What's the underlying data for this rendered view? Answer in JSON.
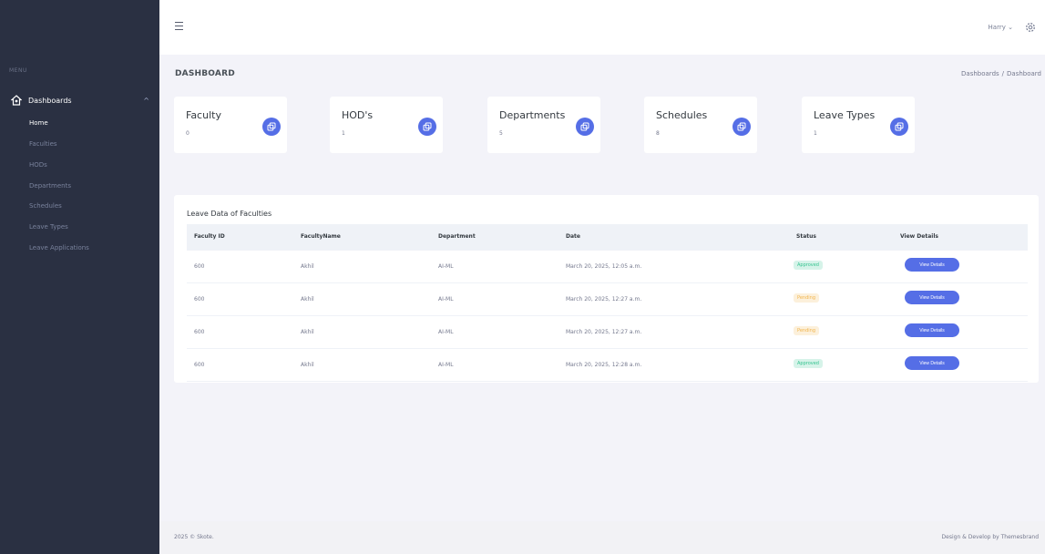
{
  "sidebar": {
    "menu_title": "Menu",
    "group_label": "Dashboards",
    "items": [
      {
        "label": "Home",
        "active": true
      },
      {
        "label": "Faculties",
        "active": false
      },
      {
        "label": "HODs",
        "active": false
      },
      {
        "label": "Departments",
        "active": false
      },
      {
        "label": "Schedules",
        "active": false
      },
      {
        "label": "Leave Types",
        "active": false
      },
      {
        "label": "Leave Applications",
        "active": false
      }
    ]
  },
  "topbar": {
    "user_name": "Harry",
    "user_caret": "⌄"
  },
  "page": {
    "title": "DASHBOARD",
    "breadcrumb": [
      "Dashboards",
      "Dashboard"
    ]
  },
  "stats": [
    {
      "label": "Faculty",
      "count": "0"
    },
    {
      "label": "HOD's",
      "count": "1"
    },
    {
      "label": "Departments",
      "count": "5"
    },
    {
      "label": "Schedules",
      "count": "8"
    },
    {
      "label": "Leave Types",
      "count": "1"
    }
  ],
  "table": {
    "title": "Leave Data of Faculties",
    "columns": [
      "Faculty ID",
      "FacultyName",
      "Department",
      "Date",
      "Status",
      "View Details"
    ],
    "rows": [
      {
        "faculty_id": "600",
        "name": "Akhil",
        "department": "AI-ML",
        "date": "March 20, 2025, 12:05 a.m.",
        "status": "Approved",
        "action": "View Details"
      },
      {
        "faculty_id": "600",
        "name": "Akhil",
        "department": "AI-ML",
        "date": "March 20, 2025, 12:27 a.m.",
        "status": "Pending",
        "action": "View Details"
      },
      {
        "faculty_id": "600",
        "name": "Akhil",
        "department": "AI-ML",
        "date": "March 20, 2025, 12:27 a.m.",
        "status": "Pending",
        "action": "View Details"
      },
      {
        "faculty_id": "600",
        "name": "Akhil",
        "department": "AI-ML",
        "date": "March 20, 2025, 12:28 a.m.",
        "status": "Approved",
        "action": "View Details"
      }
    ]
  },
  "footer": {
    "left": "2025 © Skote.",
    "right": "Design & Develop by Themesbrand"
  },
  "colors": {
    "sidebar_bg": "#2a3042",
    "accent": "#556ee6",
    "approved": "#34c38f",
    "pending": "#f1b44c",
    "page_bg": "#f3f3f9"
  }
}
